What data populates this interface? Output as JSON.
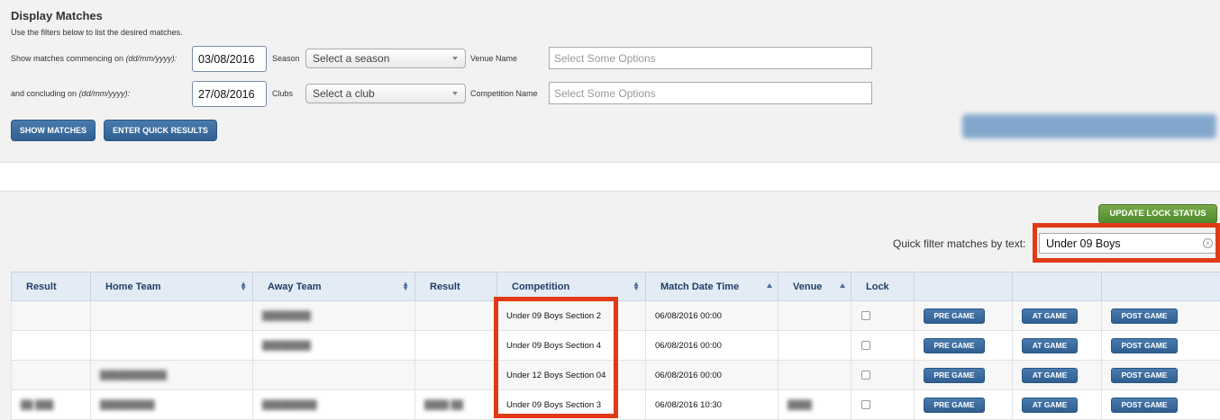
{
  "filters": {
    "title": "Display Matches",
    "subtitle": "Use the filters below to list the desired matches.",
    "start_label": "Show matches commencing on ",
    "start_format": "(dd/mm/yyyy):",
    "start_value": "03/08/2016",
    "end_label": "and concluding on ",
    "end_format": "(dd/mm/yyyy):",
    "end_value": "27/08/2016",
    "season_label": "Season",
    "season_value": "Select a season",
    "clubs_label": "Clubs",
    "clubs_value": "Select a club",
    "venue_label": "Venue Name",
    "venue_placeholder": "Select Some Options",
    "competition_label": "Competition Name",
    "competition_placeholder": "Select Some Options",
    "show_button": "SHOW MATCHES",
    "quick_results_button": "ENTER QUICK RESULTS"
  },
  "matches": {
    "update_lock_button": "UPDATE LOCK STATUS",
    "quick_filter_label": "Quick filter matches by text:",
    "quick_filter_value": "Under 09 Boys",
    "columns": [
      "Result",
      "Home Team",
      "Away Team",
      "Result",
      "Competition",
      "Match Date Time",
      "Venue",
      "Lock",
      "",
      "",
      ""
    ],
    "rows": [
      {
        "competition": "Under 09 Boys Section 2",
        "datetime": "06/08/2016 00:00"
      },
      {
        "competition": "Under 09 Boys Section 4",
        "datetime": "06/08/2016 00:00"
      },
      {
        "competition": "Under 12 Boys Section 04",
        "datetime": "06/08/2016 00:00"
      },
      {
        "competition": "Under 09 Boys Section 3",
        "datetime": "06/08/2016 10:30"
      }
    ],
    "pre_game_label": "PRE GAME",
    "at_game_label": "AT GAME",
    "post_game_label": "POST GAME"
  },
  "colors": {
    "primary_button": "#2f5f91",
    "update_button": "#4f8a2a",
    "highlight": "#e03a17",
    "header_bg": "#e3ebf5"
  }
}
